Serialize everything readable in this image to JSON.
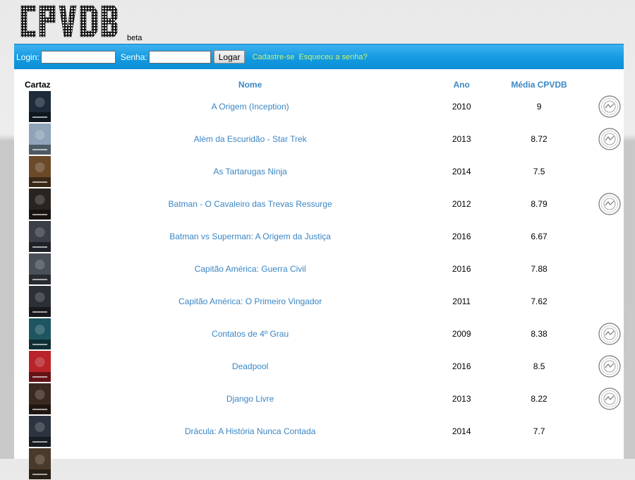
{
  "brand": {
    "logo_text": "CPVDB",
    "beta_label": "beta"
  },
  "login": {
    "login_label": "Login:",
    "senha_label": "Senha:",
    "login_value": "",
    "senha_value": "",
    "submit_label": "Logar",
    "register_link": "Cadastre-se",
    "forgot_link": "Esqueceu a senha?"
  },
  "table": {
    "headers": {
      "cartaz": "Cartaz",
      "nome": "Nome",
      "ano": "Ano",
      "media": "Média CPVDB"
    },
    "rows": [
      {
        "nome": "A Origem (Inception)",
        "ano": "2010",
        "media": "9",
        "seal": true
      },
      {
        "nome": "Além da Escuridão - Star Trek",
        "ano": "2013",
        "media": "8.72",
        "seal": true
      },
      {
        "nome": "As Tartarugas Ninja",
        "ano": "2014",
        "media": "7.5",
        "seal": false
      },
      {
        "nome": "Batman - O Cavaleiro das Trevas Ressurge",
        "ano": "2012",
        "media": "8.79",
        "seal": true
      },
      {
        "nome": "Batman vs Superman: A Origem da Justiça",
        "ano": "2016",
        "media": "6.67",
        "seal": false
      },
      {
        "nome": "Capitão América: Guerra Civil",
        "ano": "2016",
        "media": "7.88",
        "seal": false
      },
      {
        "nome": "Capitão América: O Primeiro Vingador",
        "ano": "2011",
        "media": "7.62",
        "seal": false
      },
      {
        "nome": "Contatos de 4º Grau",
        "ano": "2009",
        "media": "8.38",
        "seal": true
      },
      {
        "nome": "Deadpool",
        "ano": "2016",
        "media": "8.5",
        "seal": true
      },
      {
        "nome": "Django Livre",
        "ano": "2013",
        "media": "8.22",
        "seal": true
      },
      {
        "nome": "Drácula: A História Nunca Contada",
        "ano": "2014",
        "media": "7.7",
        "seal": false
      },
      {
        "nome": "",
        "ano": "",
        "media": "",
        "seal": false
      }
    ]
  },
  "colors": {
    "accent_blue": "#3a86c4",
    "login_bar": "#139ae1",
    "link_green": "#c8f27a",
    "posters": [
      "#1d2b3a",
      "#8fa4b8",
      "#6b4a2a",
      "#2a2420",
      "#3a3f48",
      "#4a5058",
      "#2b2f36",
      "#1e5560",
      "#b8242a",
      "#3b2a22",
      "#2d3440",
      "#4a3a2a"
    ]
  }
}
